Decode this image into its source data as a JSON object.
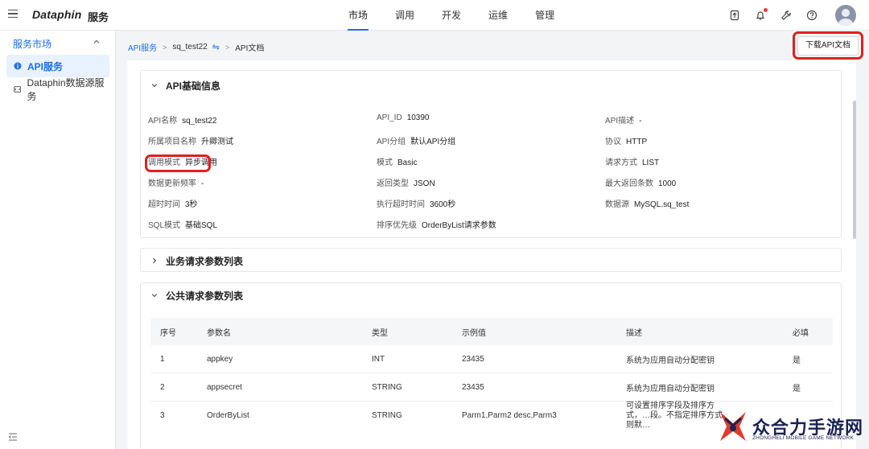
{
  "topbar": {
    "logo": "Dataphin",
    "product": "服务",
    "nav": [
      "市场",
      "调用",
      "开发",
      "运维",
      "管理"
    ],
    "active_nav": 0,
    "icons": [
      "export-icon",
      "bell-icon",
      "wrench-icon",
      "help-icon",
      "avatar"
    ]
  },
  "sidebar": {
    "title": "服务市场",
    "items": [
      {
        "label": "API服务",
        "icon": "info-circle-icon",
        "active": true
      },
      {
        "label": "Dataphin数据源服务",
        "icon": "datasource-icon",
        "active": false
      }
    ]
  },
  "breadcrumb": {
    "root": "API服务",
    "current": "sq_test22",
    "swap_glyph": "⇋",
    "page": "API文档"
  },
  "download_button": "下载API文档",
  "basic_info": {
    "title": "API基础信息",
    "rows": [
      [
        {
          "k": "API名称",
          "v": "sq_test22"
        },
        {
          "k": "API_ID",
          "v": "10390"
        },
        {
          "k": "API描述",
          "v": "-"
        }
      ],
      [
        {
          "k": "所属项目名称",
          "v": "升卿测试"
        },
        {
          "k": "API分组",
          "v": "默认API分组"
        },
        {
          "k": "协议",
          "v": "HTTP"
        }
      ],
      [
        {
          "k": "调用模式",
          "v": "异步调用"
        },
        {
          "k": "模式",
          "v": "Basic"
        },
        {
          "k": "请求方式",
          "v": "LIST"
        }
      ],
      [
        {
          "k": "数据更新频率",
          "v": "-"
        },
        {
          "k": "返回类型",
          "v": "JSON"
        },
        {
          "k": "最大返回条数",
          "v": "1000"
        }
      ],
      [
        {
          "k": "超时时间",
          "v": "3秒"
        },
        {
          "k": "执行超时时间",
          "v": "3600秒"
        },
        {
          "k": "数据源",
          "v": "MySQL.sq_test"
        }
      ],
      [
        {
          "k": "SQL模式",
          "v": "基础SQL"
        },
        {
          "k": "排序优先级",
          "v": "OrderByList请求参数"
        },
        {
          "k": "",
          "v": ""
        }
      ]
    ]
  },
  "business_params": {
    "title": "业务请求参数列表"
  },
  "public_params": {
    "title": "公共请求参数列表",
    "headers": [
      "序号",
      "参数名",
      "类型",
      "示例值",
      "描述",
      "必填"
    ],
    "rows": [
      [
        "1",
        "appkey",
        "INT",
        "23435",
        "系统为应用自动分配密钥",
        "是"
      ],
      [
        "2",
        "appsecret",
        "STRING",
        "23435",
        "系统为应用自动分配密钥",
        "是"
      ],
      [
        "3",
        "OrderByList",
        "STRING",
        "Parm1,Parm2 desc,Parm3",
        "可设置排序字段及排序方式，…段。不指定排序方式，则默…",
        ""
      ]
    ]
  },
  "watermark": {
    "title": "众合力手游网",
    "subtitle": "ZHONGHELI MOBILE GAME NETWORK"
  }
}
